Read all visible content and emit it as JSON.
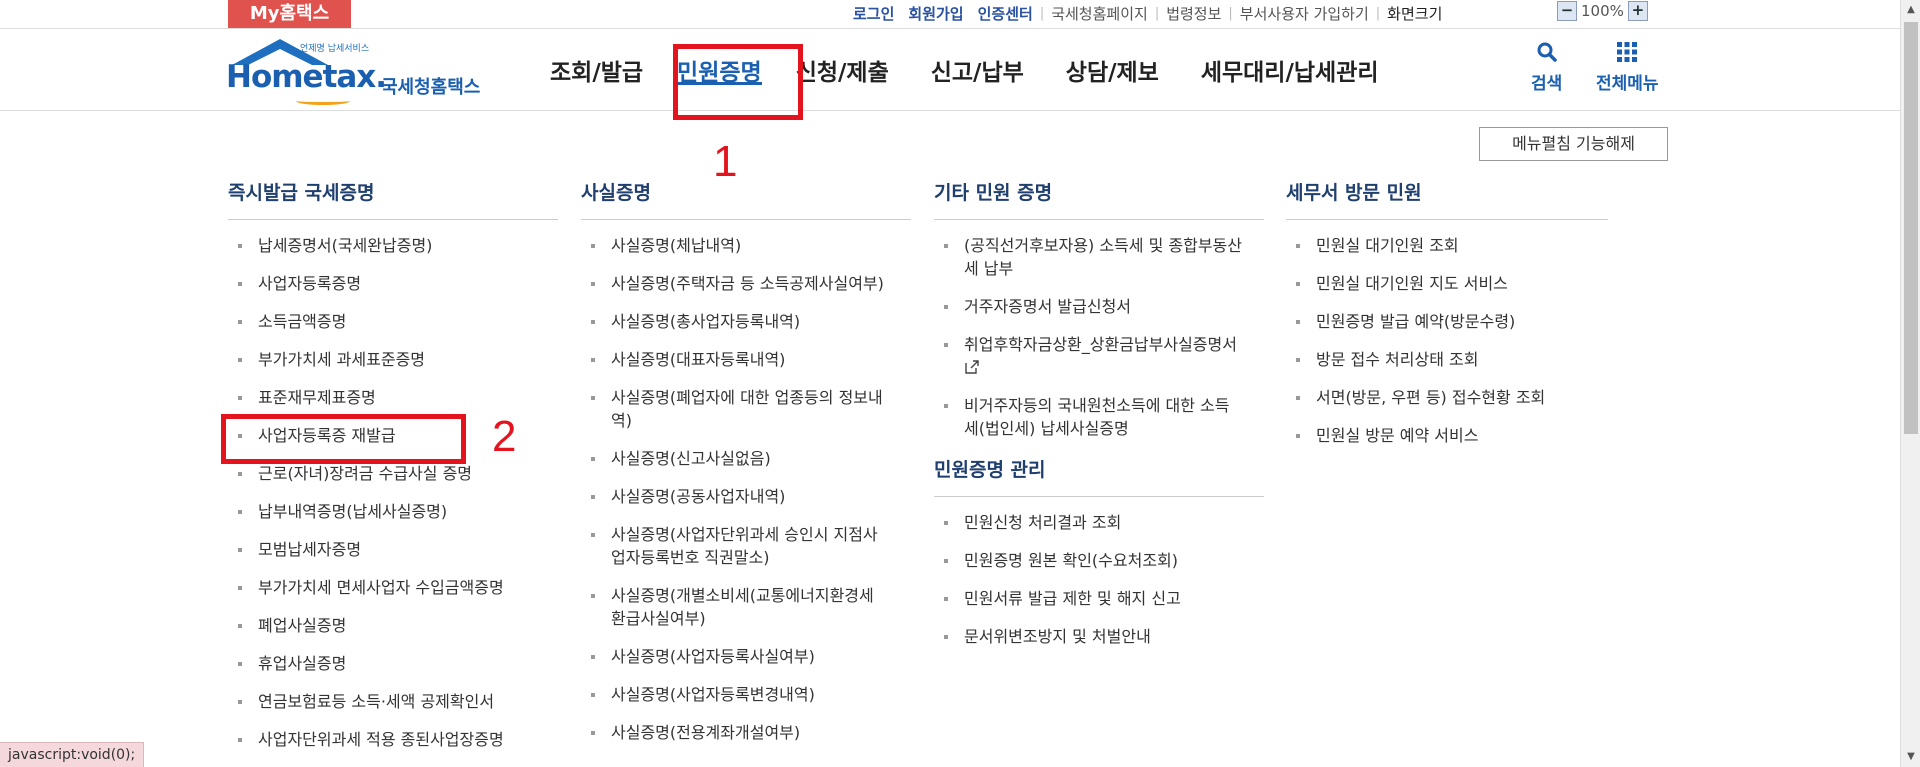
{
  "topbar": {
    "my_tab": "My홈택스",
    "links_bold": [
      "로그인",
      "회원가입",
      "인증센터"
    ],
    "links_plain": [
      "국세청홈페이지",
      "법령정보",
      "부서사용자 가입하기",
      "화면크기"
    ],
    "zoom_minus": "−",
    "zoom_level": "100%",
    "zoom_plus": "+"
  },
  "logo": {
    "sub_text": "언제명 납세서비스",
    "word": "Hometax.",
    "korean_name": "국세청홈택스"
  },
  "gnb": {
    "items": [
      "조회/발급",
      "민원증명",
      "신청/제출",
      "신고/납부",
      "상담/제보",
      "세무대리/납세관리"
    ],
    "active_index": 1
  },
  "tools": {
    "search_label": "검색",
    "all_menu_label": "전체메뉴"
  },
  "fold_button": "메뉴펼침 기능해제",
  "annotations": [
    "1",
    "2"
  ],
  "columns": [
    {
      "heading": "즉시발급 국세증명",
      "items": [
        "납세증명서(국세완납증명)",
        "사업자등록증명",
        "소득금액증명",
        "부가가치세 과세표준증명",
        "표준재무제표증명",
        "사업자등록증 재발급",
        "근로(자녀)장려금 수급사실 증명",
        "납부내역증명(납세사실증명)",
        "모범납세자증명",
        "부가가치세 면세사업자 수입금액증명",
        "폐업사실증명",
        "휴업사실증명",
        "연금보험료등 소득·세액 공제확인서",
        "사업자단위과세 적용 종된사업장증명"
      ]
    },
    {
      "heading": "사실증명",
      "items": [
        "사실증명(체납내역)",
        "사실증명(주택자금 등 소득공제사실여부)",
        "사실증명(총사업자등록내역)",
        "사실증명(대표자등록내역)",
        "사실증명(폐업자에 대한 업종등의 정보내역)",
        "사실증명(신고사실없음)",
        "사실증명(공동사업자내역)",
        "사실증명(사업자단위과세 승인시 지점사업자등록번호 직권말소)",
        "사실증명(개별소비세(교통에너지환경세 환급사실여부)",
        "사실증명(사업자등록사실여부)",
        "사실증명(사업자등록변경내역)",
        "사실증명(전용계좌개설여부)"
      ]
    },
    {
      "heading": "기타 민원 증명",
      "items": [
        "(공직선거후보자용) 소득세 및 종합부동산세 납부",
        "거주자증명서 발급신청서",
        "취업후학자금상환_상환금납부사실증명서",
        "비거주자등의 국내원천소득에 대한 소득세(법인세) 납세사실증명"
      ],
      "sub_heading": "민원증명 관리",
      "sub_items": [
        "민원신청 처리결과 조회",
        "민원증명 원본 확인(수요처조회)",
        "민원서류 발급 제한 및 해지 신고",
        "문서위변조방지 및 처벌안내"
      ]
    },
    {
      "heading": "세무서 방문 민원",
      "items": [
        "민원실 대기인원 조회",
        "민원실 대기인원 지도 서비스",
        "민원증명 발급 예약(방문수령)",
        "방문 접수 처리상태 조회",
        "서면(방문, 우편 등) 접수현황 조회",
        "민원실 방문 예약 서비스"
      ]
    }
  ],
  "statusbar": "javascript:void(0);"
}
